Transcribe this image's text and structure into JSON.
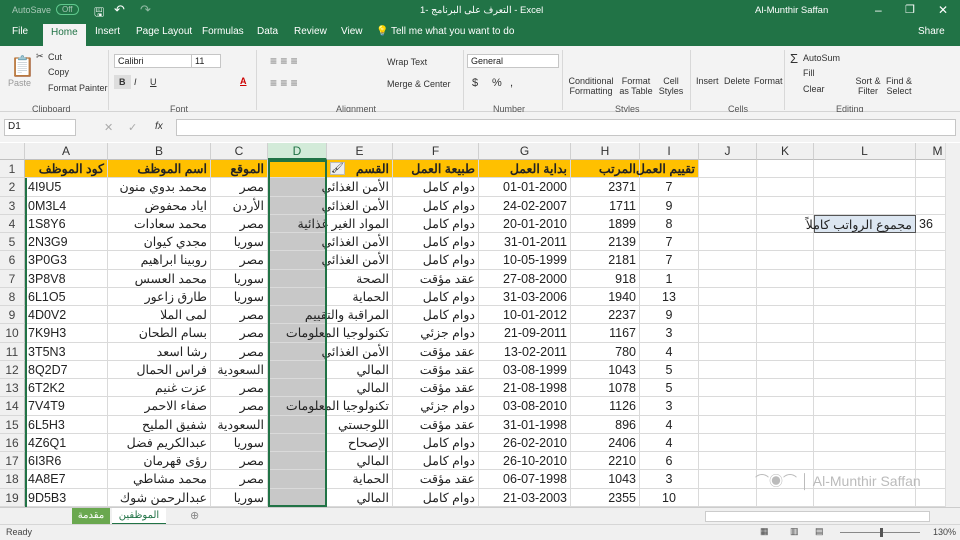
{
  "titlebar": {
    "autosave": "AutoSave",
    "autosave_state": "Off",
    "title": "1- التعرف على البرنامج - Excel",
    "user": "Al-Munthir Saffan"
  },
  "tabs": [
    "File",
    "Home",
    "Insert",
    "Page Layout",
    "Formulas",
    "Data",
    "Review",
    "View"
  ],
  "tell_me": "Tell me what you want to do",
  "share": "Share",
  "ribbon": {
    "clipboard": {
      "paste": "Paste",
      "cut": "Cut",
      "copy": "Copy",
      "format_painter": "Format Painter",
      "label": "Clipboard"
    },
    "font": {
      "name": "Calibri",
      "size": "11",
      "bold": "B",
      "italic": "I",
      "underline": "U",
      "label": "Font"
    },
    "alignment": {
      "wrap": "Wrap Text",
      "merge": "Merge & Center",
      "label": "Alignment"
    },
    "number": {
      "format": "General",
      "currency": "$",
      "percent": "%",
      "comma": ",",
      "label": "Number"
    },
    "styles": {
      "conditional": "Conditional Formatting",
      "format_table": "Format as Table",
      "cell_styles": "Cell Styles",
      "label": "Styles"
    },
    "cells": {
      "insert": "Insert",
      "delete": "Delete",
      "format": "Format",
      "label": "Cells"
    },
    "editing": {
      "autosum": "AutoSum",
      "fill": "Fill",
      "clear": "Clear",
      "sort": "Sort & Filter",
      "find": "Find & Select",
      "label": "Editing"
    }
  },
  "formula_bar": {
    "name_box": "D1",
    "fx": "fx",
    "value": ""
  },
  "columns": [
    "A",
    "B",
    "C",
    "D",
    "E",
    "F",
    "G",
    "H",
    "I",
    "J",
    "K",
    "L",
    "M"
  ],
  "headers": [
    "كود الموظف",
    "اسم الموظف",
    "الموقع",
    "",
    "القسم",
    "طبيعة العمل",
    "بداية العمل",
    "المرتب",
    "تقييم العمل"
  ],
  "rows": [
    [
      "4I9U5",
      "محمد بدوي منون",
      "مصر",
      "",
      "الأمن الغذائي",
      "دوام كامل",
      "01-01-2000",
      "2371",
      "7"
    ],
    [
      "0M3L4",
      "اياد محفوض",
      "الأردن",
      "",
      "الأمن الغذائي",
      "دوام كامل",
      "24-02-2007",
      "1711",
      "9"
    ],
    [
      "1S8Y6",
      "محمد سعادات",
      "مصر",
      "",
      "المواد الغير غذائية",
      "دوام كامل",
      "20-01-2010",
      "1899",
      "8"
    ],
    [
      "2N3G9",
      "مجدي كيوان",
      "سوريا",
      "",
      "الأمن الغذائي",
      "دوام كامل",
      "31-01-2011",
      "2139",
      "7"
    ],
    [
      "3P0G3",
      "روبينا ابراهيم",
      "مصر",
      "",
      "الأمن الغذائي",
      "دوام كامل",
      "10-05-1999",
      "2181",
      "7"
    ],
    [
      "3P8V8",
      "محمد العسس",
      "سوريا",
      "",
      "الصحة",
      "عقد مؤقت",
      "27-08-2000",
      "918",
      "1"
    ],
    [
      "6L1O5",
      "طارق زاعور",
      "سوريا",
      "",
      "الحماية",
      "دوام كامل",
      "31-03-2006",
      "1940",
      "13"
    ],
    [
      "4D0V2",
      "لمى الملا",
      "مصر",
      "",
      "المراقبة والتقييم",
      "دوام كامل",
      "10-01-2012",
      "2237",
      "9"
    ],
    [
      "7K9H3",
      "بسام الطحان",
      "مصر",
      "",
      "تكنولوجيا المعلومات",
      "دوام جزئي",
      "21-09-2011",
      "1167",
      "3"
    ],
    [
      "3T5N3",
      "رشا اسعد",
      "مصر",
      "",
      "الأمن الغذائي",
      "عقد مؤقت",
      "13-02-2011",
      "780",
      "4"
    ],
    [
      "8Q2D7",
      "فراس الحمال",
      "السعودية",
      "",
      "المالي",
      "عقد مؤقت",
      "03-08-1999",
      "1043",
      "5"
    ],
    [
      "6T2K2",
      "عزت غنيم",
      "مصر",
      "",
      "المالي",
      "عقد مؤقت",
      "21-08-1998",
      "1078",
      "5"
    ],
    [
      "7V4T9",
      "صفاء الاحمر",
      "مصر",
      "",
      "تكنولوجيا المعلومات",
      "دوام جزئي",
      "03-08-2010",
      "1126",
      "3"
    ],
    [
      "6L5H3",
      "شفيق المليح",
      "السعودية",
      "",
      "اللوجستي",
      "عقد مؤقت",
      "31-01-1998",
      "896",
      "4"
    ],
    [
      "4Z6Q1",
      "عبدالكريم فضل",
      "سوريا",
      "",
      "الإصحاح",
      "دوام كامل",
      "26-02-2010",
      "2406",
      "4"
    ],
    [
      "6I3R6",
      "رؤى قهرمان",
      "مصر",
      "",
      "المالي",
      "دوام كامل",
      "26-10-2010",
      "2210",
      "6"
    ],
    [
      "4A8E7",
      "محمد  مشاطي",
      "مصر",
      "",
      "الحماية",
      "عقد مؤقت",
      "06-07-1998",
      "1043",
      "3"
    ],
    [
      "9D5B3",
      "عبدالرحمن شوك",
      "سوريا",
      "",
      "المالي",
      "دوام كامل",
      "21-03-2003",
      "2355",
      "10"
    ]
  ],
  "summary": {
    "label": "مجموع الرواتب كاملاً",
    "value": "36"
  },
  "sheets": [
    {
      "name": "مقدمة",
      "active": false
    },
    {
      "name": "الموظفين",
      "active": true
    }
  ],
  "status": {
    "ready": "Ready",
    "zoom": "130%"
  },
  "watermark": "Al-Munthir Saffan",
  "colors": {
    "excel_green": "#217346",
    "header_fill": "#ffc000",
    "selected_column": "#c8c8c8",
    "summary_fill": "#dce6f1"
  }
}
